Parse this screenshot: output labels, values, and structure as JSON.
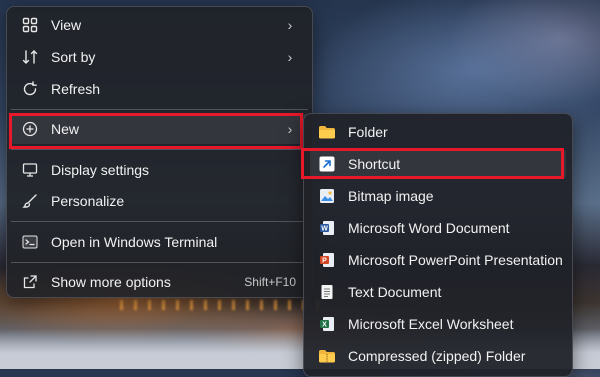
{
  "context_menu": {
    "items": [
      {
        "label": "View",
        "icon": "grid-icon",
        "has_submenu": true
      },
      {
        "label": "Sort by",
        "icon": "sort-icon",
        "has_submenu": true
      },
      {
        "label": "Refresh",
        "icon": "refresh-icon",
        "has_submenu": false
      },
      {
        "label": "New",
        "icon": "plus-circle-icon",
        "has_submenu": true,
        "highlighted": true
      },
      {
        "label": "Display settings",
        "icon": "display-icon",
        "has_submenu": false
      },
      {
        "label": "Personalize",
        "icon": "brush-icon",
        "has_submenu": false
      },
      {
        "label": "Open in Windows Terminal",
        "icon": "terminal-icon",
        "has_submenu": false
      },
      {
        "label": "Show more options",
        "icon": "share-icon",
        "shortcut": "Shift+F10"
      }
    ]
  },
  "new_submenu": {
    "items": [
      {
        "label": "Folder",
        "icon": "folder-icon"
      },
      {
        "label": "Shortcut",
        "icon": "shortcut-icon",
        "highlighted": true
      },
      {
        "label": "Bitmap image",
        "icon": "bitmap-icon"
      },
      {
        "label": "Microsoft Word Document",
        "icon": "word-icon"
      },
      {
        "label": "Microsoft PowerPoint Presentation",
        "icon": "powerpoint-icon"
      },
      {
        "label": "Text Document",
        "icon": "text-document-icon"
      },
      {
        "label": "Microsoft Excel Worksheet",
        "icon": "excel-icon"
      },
      {
        "label": "Compressed (zipped) Folder",
        "icon": "zip-folder-icon"
      }
    ]
  },
  "colors": {
    "highlight_border": "#e8182b",
    "menu_bg": "#202228",
    "text": "#f2f2f2"
  }
}
